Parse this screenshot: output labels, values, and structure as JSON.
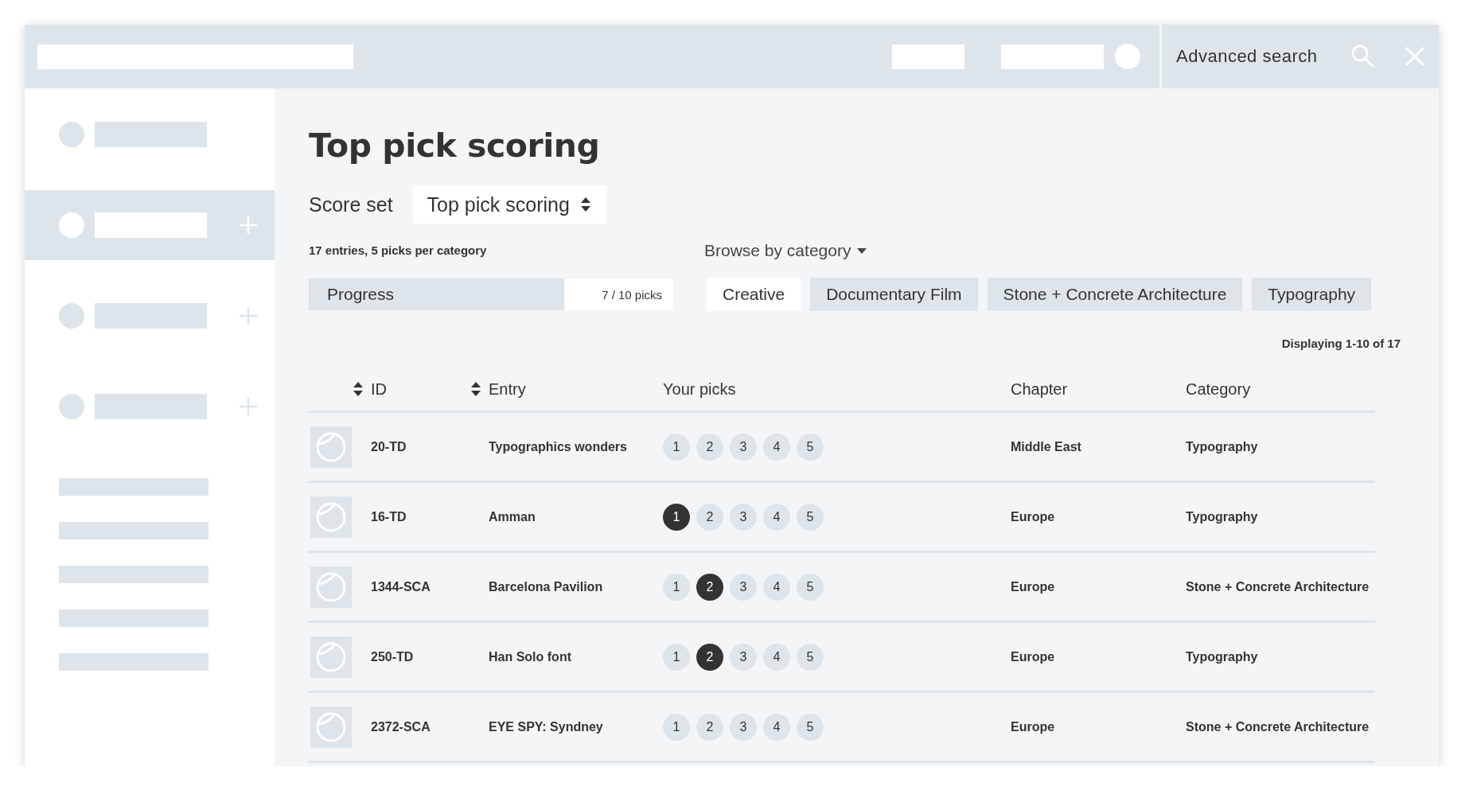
{
  "top_bar": {
    "advanced_search": "Advanced search"
  },
  "sidebar": {
    "items": [
      {
        "selected": false,
        "expandable": false
      },
      {
        "selected": true,
        "expandable": true
      },
      {
        "selected": false,
        "expandable": true
      },
      {
        "selected": false,
        "expandable": true
      }
    ]
  },
  "title": "Top pick scoring",
  "score_set": {
    "label": "Score set",
    "value": "Top pick scoring"
  },
  "summary": "17 entries, 5 picks per category",
  "progress": {
    "label": "Progress",
    "level": 0.7,
    "reading": "7 / 10 picks"
  },
  "browse": {
    "label": "Browse by category"
  },
  "category_tabs": [
    {
      "label": "Creative",
      "selected": true
    },
    {
      "label": "Documentary Film",
      "selected": false
    },
    {
      "label": "Stone + Concrete Architecture",
      "selected": false
    },
    {
      "label": "Typography",
      "selected": false
    }
  ],
  "pagination": "Displaying 1-10 of 17",
  "table": {
    "columns": [
      {
        "label": "ID",
        "sortable": true
      },
      {
        "label": "Entry",
        "sortable": true
      },
      {
        "label": "Your picks",
        "sortable": false
      },
      {
        "label": "Chapter",
        "sortable": false
      },
      {
        "label": "Category",
        "sortable": false
      }
    ],
    "rows": [
      {
        "id": "20-TD",
        "entry": "Typographics wonders",
        "picks": [
          {
            "label": "1",
            "selected": false
          },
          {
            "label": "2",
            "selected": false
          },
          {
            "label": "3",
            "selected": false
          },
          {
            "label": "4",
            "selected": false
          },
          {
            "label": "5",
            "selected": false
          }
        ],
        "chapter": "Middle East",
        "category": "Typography"
      },
      {
        "id": "16-TD",
        "entry": "Amman",
        "picks": [
          {
            "label": "1",
            "selected": true
          },
          {
            "label": "2",
            "selected": false
          },
          {
            "label": "3",
            "selected": false
          },
          {
            "label": "4",
            "selected": false
          },
          {
            "label": "5",
            "selected": false
          }
        ],
        "chapter": "Europe",
        "category": "Typography"
      },
      {
        "id": "1344-SCA",
        "entry": "Barcelona Pavilion",
        "picks": [
          {
            "label": "1",
            "selected": false
          },
          {
            "label": "2",
            "selected": true
          },
          {
            "label": "3",
            "selected": false
          },
          {
            "label": "4",
            "selected": false
          },
          {
            "label": "5",
            "selected": false
          }
        ],
        "chapter": "Europe",
        "category": "Stone + Concrete Architecture"
      },
      {
        "id": "250-TD",
        "entry": "Han Solo font",
        "picks": [
          {
            "label": "1",
            "selected": false
          },
          {
            "label": "2",
            "selected": true
          },
          {
            "label": "3",
            "selected": false
          },
          {
            "label": "4",
            "selected": false
          },
          {
            "label": "5",
            "selected": false
          }
        ],
        "chapter": "Europe",
        "category": "Typography"
      },
      {
        "id": "2372-SCA",
        "entry": "EYE SPY: Syndney",
        "picks": [
          {
            "label": "1",
            "selected": false
          },
          {
            "label": "2",
            "selected": false
          },
          {
            "label": "3",
            "selected": false
          },
          {
            "label": "4",
            "selected": false
          },
          {
            "label": "5",
            "selected": false
          }
        ],
        "chapter": "Europe",
        "category": "Stone + Concrete Architecture"
      }
    ]
  }
}
